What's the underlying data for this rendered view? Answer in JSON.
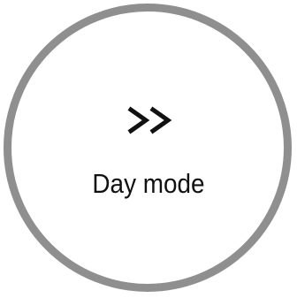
{
  "mode_button": {
    "label": "Day mode",
    "icon": "fast-forward-chevrons-icon"
  },
  "colors": {
    "ring": "#8f8f8f",
    "background": "#ffffff",
    "text": "#111111"
  }
}
